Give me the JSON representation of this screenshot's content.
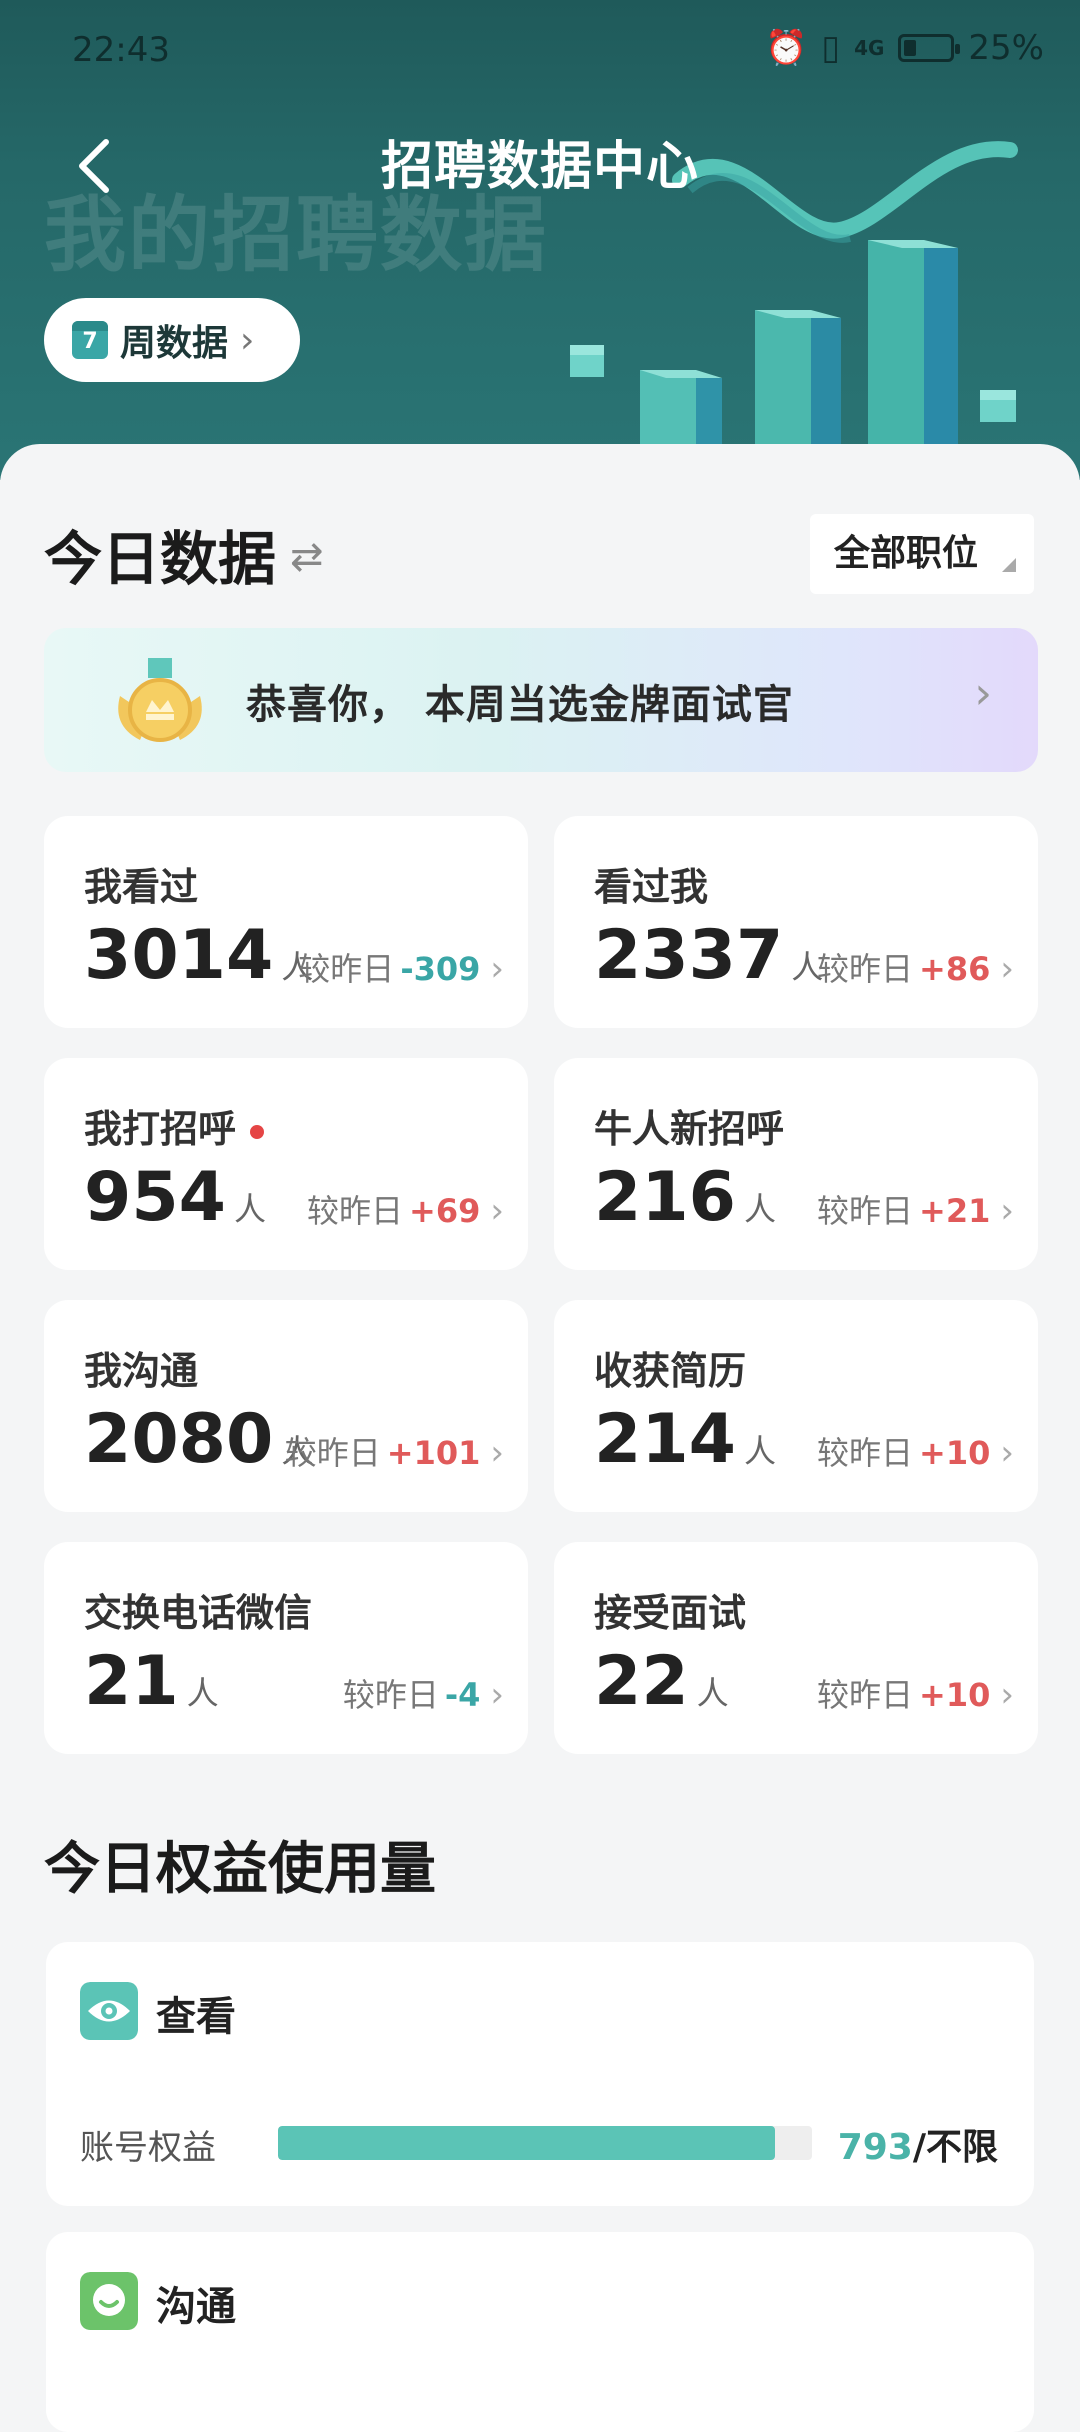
{
  "status_bar": {
    "time": "22:43",
    "signal": "4G",
    "battery": "25%"
  },
  "nav": {
    "title": "招聘数据中心"
  },
  "header": {
    "ghost_title": "我的招聘数据",
    "week_button": "周数据",
    "calendar_day": "7"
  },
  "today": {
    "title": "今日数据",
    "position_filter": "全部职位",
    "banner_text": "恭喜你， 本周当选金牌面试官"
  },
  "stats": [
    {
      "label": "我看过",
      "value": "3014",
      "unit": "人",
      "compare_label": "较昨日",
      "delta": "-309",
      "trend": "down",
      "dot": false
    },
    {
      "label": "看过我",
      "value": "2337",
      "unit": "人",
      "compare_label": "较昨日",
      "delta": "+86",
      "trend": "up",
      "dot": false
    },
    {
      "label": "我打招呼",
      "value": "954",
      "unit": "人",
      "compare_label": "较昨日",
      "delta": "+69",
      "trend": "up",
      "dot": true
    },
    {
      "label": "牛人新招呼",
      "value": "216",
      "unit": "人",
      "compare_label": "较昨日",
      "delta": "+21",
      "trend": "up",
      "dot": false
    },
    {
      "label": "我沟通",
      "value": "2080",
      "unit": "人",
      "compare_label": "较昨日",
      "delta": "+101",
      "trend": "up",
      "dot": false
    },
    {
      "label": "收获简历",
      "value": "214",
      "unit": "人",
      "compare_label": "较昨日",
      "delta": "+10",
      "trend": "up",
      "dot": false
    },
    {
      "label": "交换电话微信",
      "value": "21",
      "unit": "人",
      "compare_label": "较昨日",
      "delta": "-4",
      "trend": "down",
      "dot": false
    },
    {
      "label": "接受面试",
      "value": "22",
      "unit": "人",
      "compare_label": "较昨日",
      "delta": "+10",
      "trend": "up",
      "dot": false
    }
  ],
  "benefits": {
    "title": "今日权益使用量",
    "items": [
      {
        "name": "查看",
        "icon": "eye-icon",
        "label": "账号权益",
        "used": "793",
        "limit": "/不限",
        "progress": 0.93
      },
      {
        "name": "沟通",
        "icon": "chat-icon"
      }
    ]
  },
  "colors": {
    "header": "#256868",
    "accent": "#3aa6a6",
    "up": "#e05a5a",
    "down": "#3aa6a6",
    "progress": "#5bc4b6"
  }
}
